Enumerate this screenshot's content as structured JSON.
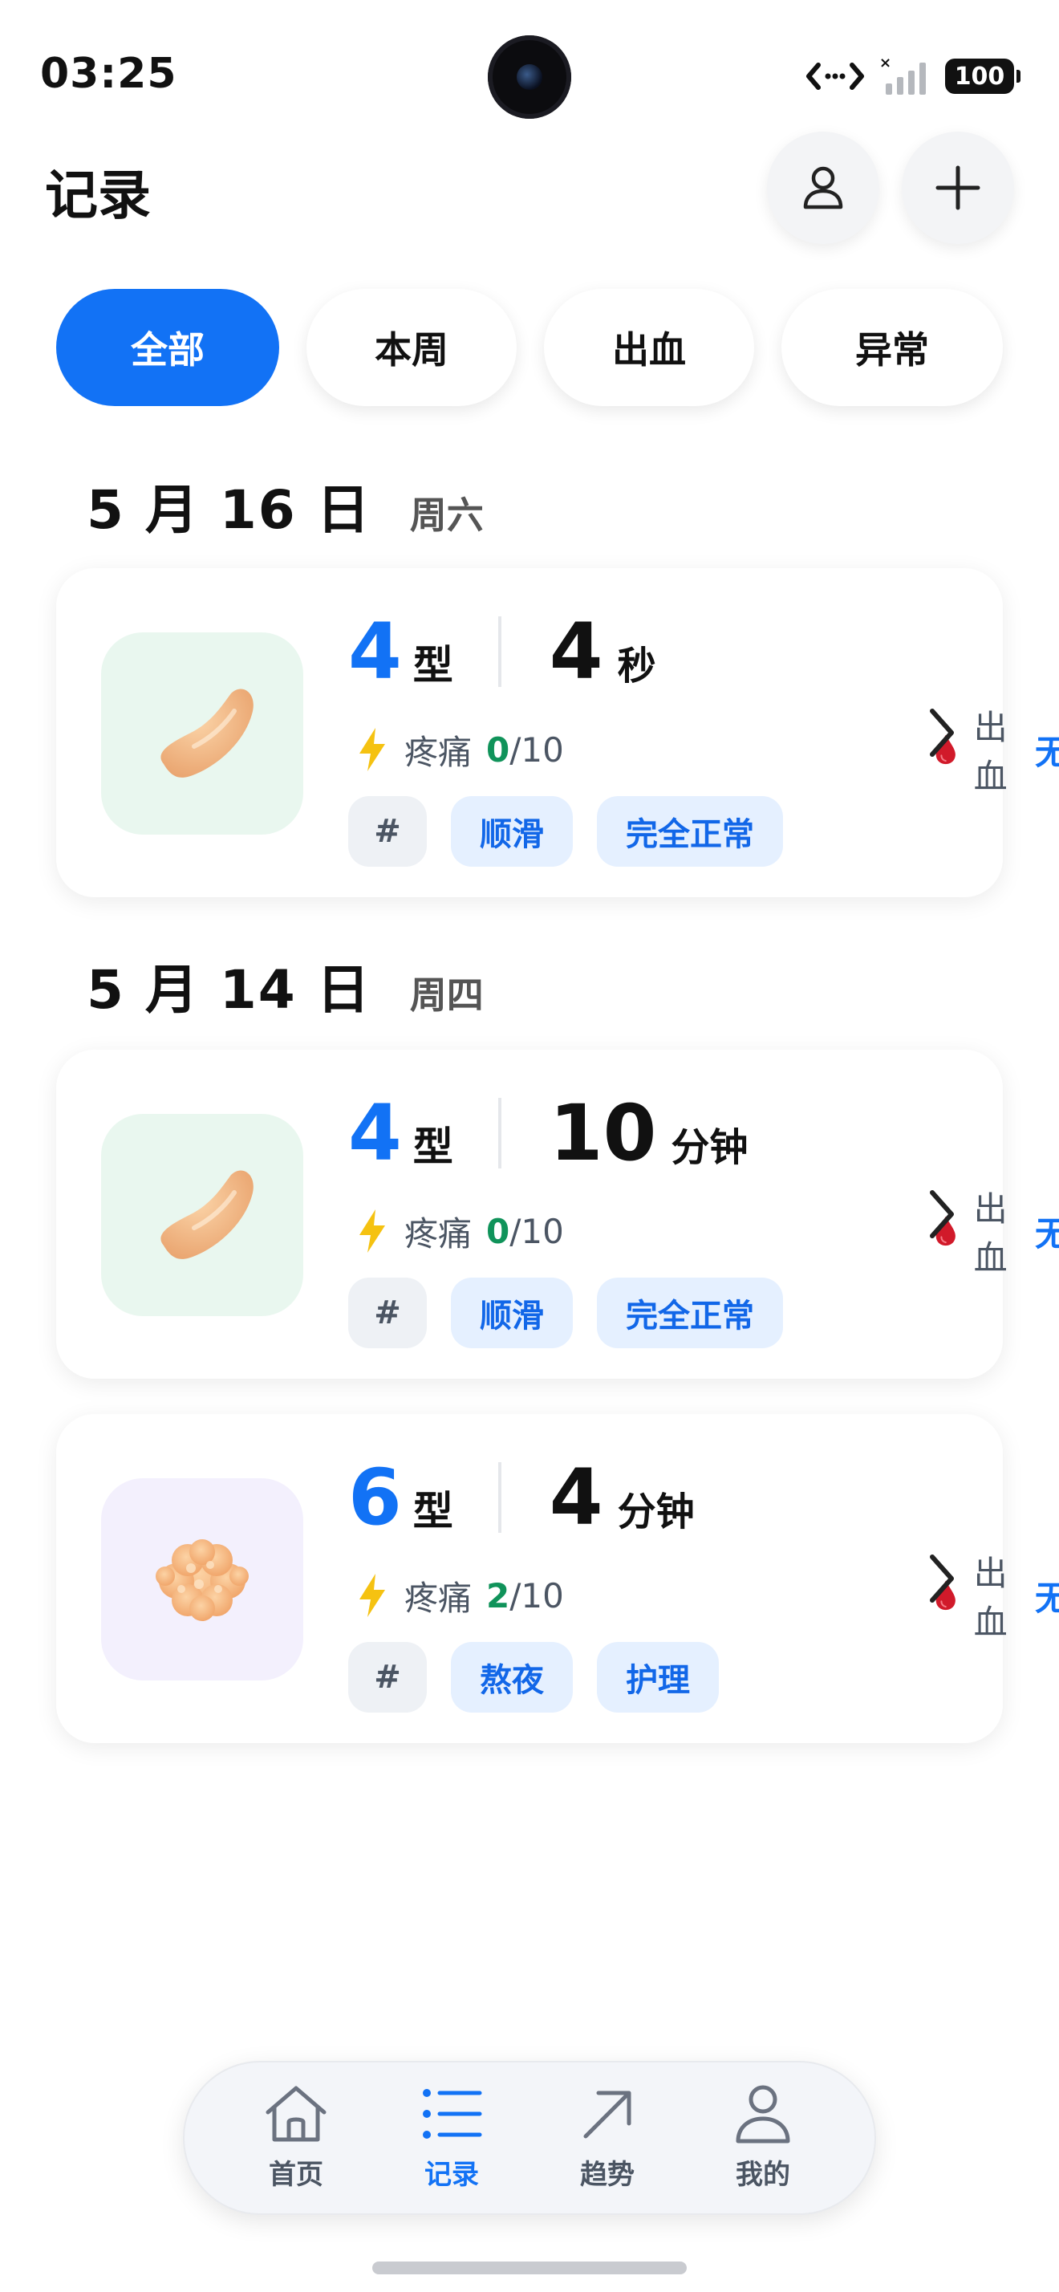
{
  "status_bar": {
    "time": "03:25",
    "battery": "100"
  },
  "header": {
    "title": "记录",
    "profile_icon": "person-icon",
    "add_icon": "plus-icon"
  },
  "filters": [
    {
      "label": "全部",
      "active": true
    },
    {
      "label": "本周",
      "active": false
    },
    {
      "label": "出血",
      "active": false
    },
    {
      "label": "异常",
      "active": false
    }
  ],
  "groups": [
    {
      "date": "5 月 16 日",
      "weekday": "周六",
      "records": [
        {
          "type_num": "4",
          "type_unit": "型",
          "duration_num": "4",
          "duration_unit": "秒",
          "pain_label": "疼痛",
          "pain_value": "0",
          "pain_max": "/10",
          "bleed_label": "出血",
          "bleed_value": "无",
          "tags": [
            "#",
            "顺滑",
            "完全正常"
          ],
          "thumb": "sausage",
          "thumb_bg": "#e9f7ef"
        }
      ]
    },
    {
      "date": "5 月 14 日",
      "weekday": "周四",
      "records": [
        {
          "type_num": "4",
          "type_unit": "型",
          "duration_num": "10",
          "duration_unit": "分钟",
          "pain_label": "疼痛",
          "pain_value": "0",
          "pain_max": "/10",
          "bleed_label": "出血",
          "bleed_value": "无",
          "tags": [
            "#",
            "顺滑",
            "完全正常"
          ],
          "thumb": "sausage",
          "thumb_bg": "#e9f7ef"
        },
        {
          "type_num": "6",
          "type_unit": "型",
          "duration_num": "4",
          "duration_unit": "分钟",
          "pain_label": "疼痛",
          "pain_value": "2",
          "pain_max": "/10",
          "bleed_label": "出血",
          "bleed_value": "无",
          "tags": [
            "#",
            "熬夜",
            "护理"
          ],
          "thumb": "mushy",
          "thumb_bg": "#f3f0fd"
        }
      ]
    }
  ],
  "bottom_nav": [
    {
      "label": "首页",
      "icon": "home-icon",
      "active": false
    },
    {
      "label": "记录",
      "icon": "list-icon",
      "active": true
    },
    {
      "label": "趋势",
      "icon": "trend-arrow-icon",
      "active": false
    },
    {
      "label": "我的",
      "icon": "person-icon",
      "active": false
    }
  ],
  "colors": {
    "accent": "#1272f5",
    "pain_ok": "#10935a",
    "tag_bg": "#e5f0ff"
  }
}
